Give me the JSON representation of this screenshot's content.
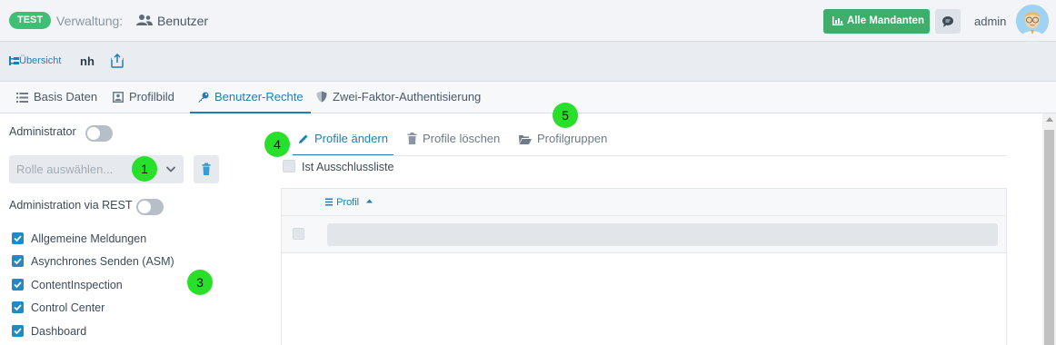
{
  "header": {
    "env_badge": "TEST",
    "app_title": "Verwaltung:",
    "page_name": "Benutzer",
    "mandanten_button": "Alle Mandanten",
    "user_name": "admin",
    "colors": {
      "accent": "#1f7fb5",
      "success": "#3fae6a",
      "badge": "#3fbf74"
    }
  },
  "toolbar": {
    "overview_label": "Übersicht",
    "record_name": "nh"
  },
  "tabs": [
    {
      "label": "Basis Daten",
      "icon": "list-icon",
      "active": false
    },
    {
      "label": "Profilbild",
      "icon": "image-icon",
      "active": false
    },
    {
      "label": "Benutzer-Rechte",
      "icon": "key-icon",
      "active": true
    },
    {
      "label": "Zwei-Faktor-Authentisierung",
      "icon": "shield-icon",
      "active": false
    }
  ],
  "left": {
    "administrator_label": "Administrator",
    "role_placeholder": "Rolle auswählen...",
    "rest_label": "Administration via REST",
    "permissions": [
      {
        "label": "Allgemeine Meldungen",
        "checked": true
      },
      {
        "label": "Asynchrones Senden (ASM)",
        "checked": true
      },
      {
        "label": "ContentInspection",
        "checked": true
      },
      {
        "label": "Control Center",
        "checked": true
      },
      {
        "label": "Dashboard",
        "checked": true
      }
    ]
  },
  "right": {
    "subtabs": [
      {
        "label": "Profile ändern",
        "icon": "pencil-icon",
        "active": true
      },
      {
        "label": "Profile löschen",
        "icon": "trash-icon",
        "active": false
      },
      {
        "label": "Profilgruppen",
        "icon": "folder-open-icon",
        "active": false
      }
    ],
    "exclusion_label": "Ist Ausschlussliste",
    "grid": {
      "column": "Profil",
      "sort": "ascending"
    }
  },
  "markers": [
    "1",
    "3",
    "4",
    "5"
  ]
}
